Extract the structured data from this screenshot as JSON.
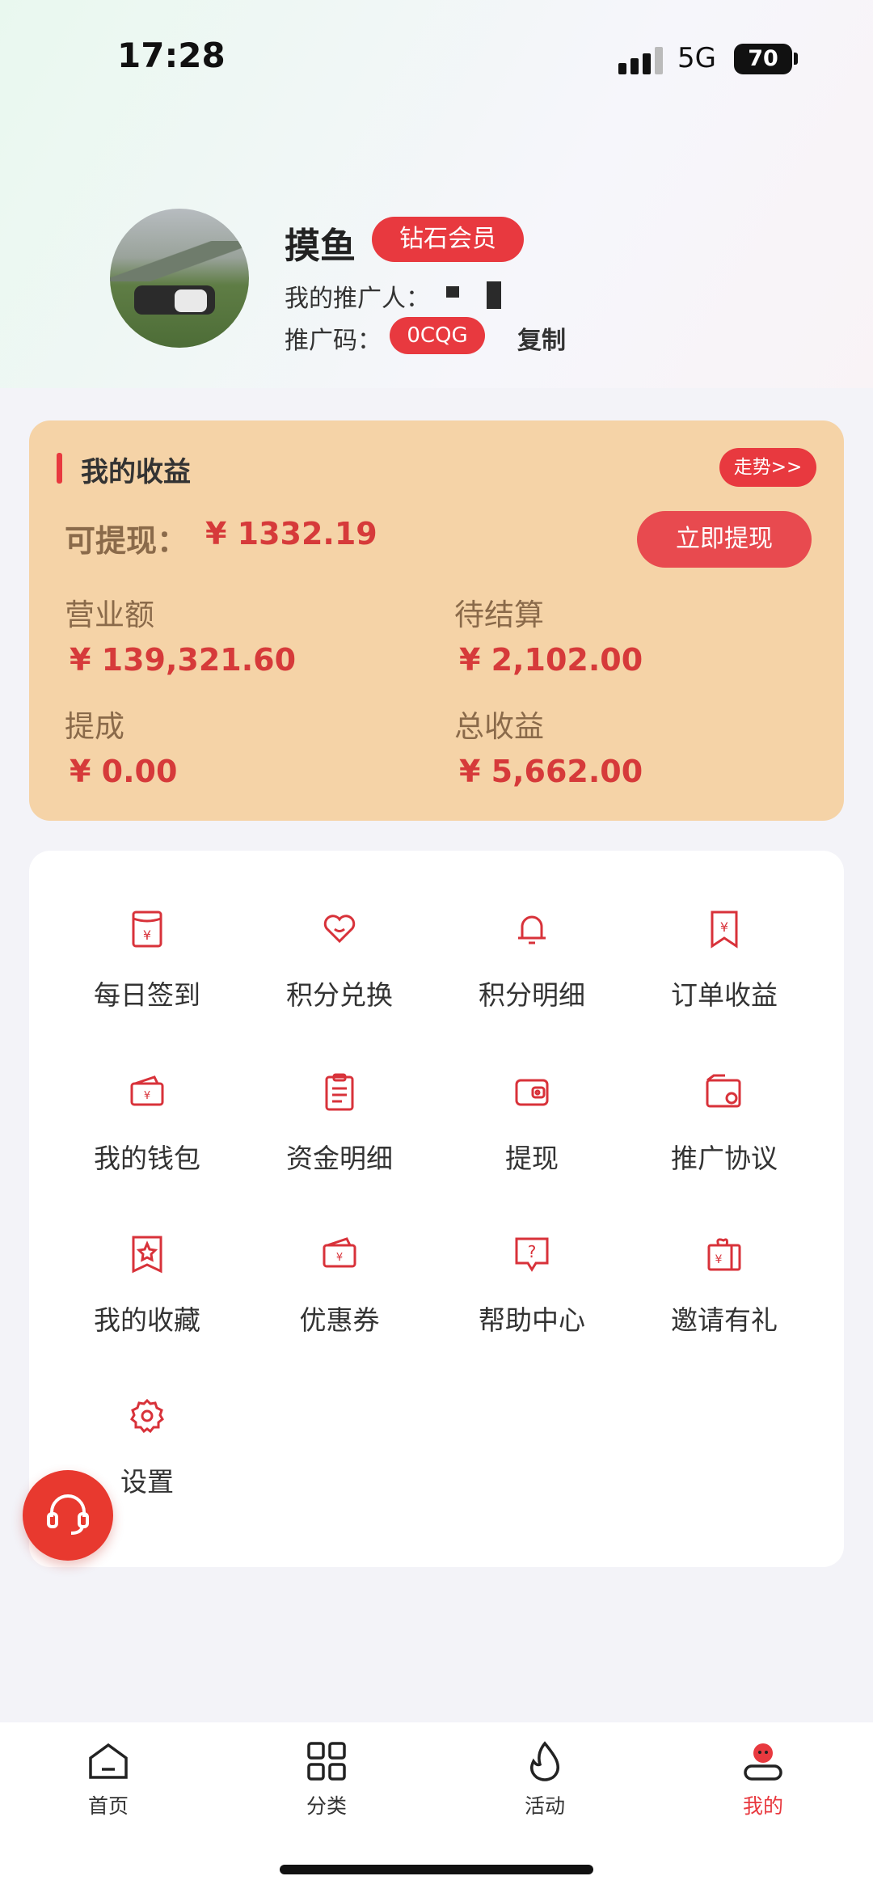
{
  "status_bar": {
    "time": "17:28",
    "network": "5G",
    "battery": "70"
  },
  "profile": {
    "nickname": "摸鱼",
    "member_level": "钻石会员",
    "referrer_label": "我的推广人：",
    "code_label": "推广码：",
    "code_value": "0CQG",
    "copy_label": "复制"
  },
  "earnings": {
    "title": "我的收益",
    "trend_label": "走势>>",
    "withdrawable_label": "可提现：",
    "withdrawable_value": "¥ 1332.19",
    "withdraw_button": "立即提现",
    "stats": [
      {
        "label": "营业额",
        "value": "¥ 139,321.60"
      },
      {
        "label": "待结算",
        "value": "¥ 2,102.00"
      },
      {
        "label": "提成",
        "value": "¥ 0.00"
      },
      {
        "label": "总收益",
        "value": "¥ 5,662.00"
      }
    ]
  },
  "menu": [
    {
      "label": "每日签到",
      "icon": "checkin-icon"
    },
    {
      "label": "积分兑换",
      "icon": "heart-icon"
    },
    {
      "label": "积分明细",
      "icon": "bell-icon"
    },
    {
      "label": "订单收益",
      "icon": "order-income-icon"
    },
    {
      "label": "我的钱包",
      "icon": "wallet-icon"
    },
    {
      "label": "资金明细",
      "icon": "clipboard-icon"
    },
    {
      "label": "提现",
      "icon": "withdraw-icon"
    },
    {
      "label": "推广协议",
      "icon": "agreement-icon"
    },
    {
      "label": "我的收藏",
      "icon": "star-icon"
    },
    {
      "label": "优惠券",
      "icon": "coupon-icon"
    },
    {
      "label": "帮助中心",
      "icon": "help-icon"
    },
    {
      "label": "邀请有礼",
      "icon": "gift-icon"
    },
    {
      "label": "设置",
      "icon": "gear-icon"
    }
  ],
  "bottom_nav": [
    {
      "label": "首页",
      "icon": "home-icon"
    },
    {
      "label": "分类",
      "icon": "grid-icon"
    },
    {
      "label": "活动",
      "icon": "fire-icon"
    },
    {
      "label": "我的",
      "icon": "profile-icon",
      "active": true
    }
  ],
  "colors": {
    "accent": "#e8393f",
    "card": "#f5d3a7",
    "stat_label": "#8a6a4a"
  }
}
